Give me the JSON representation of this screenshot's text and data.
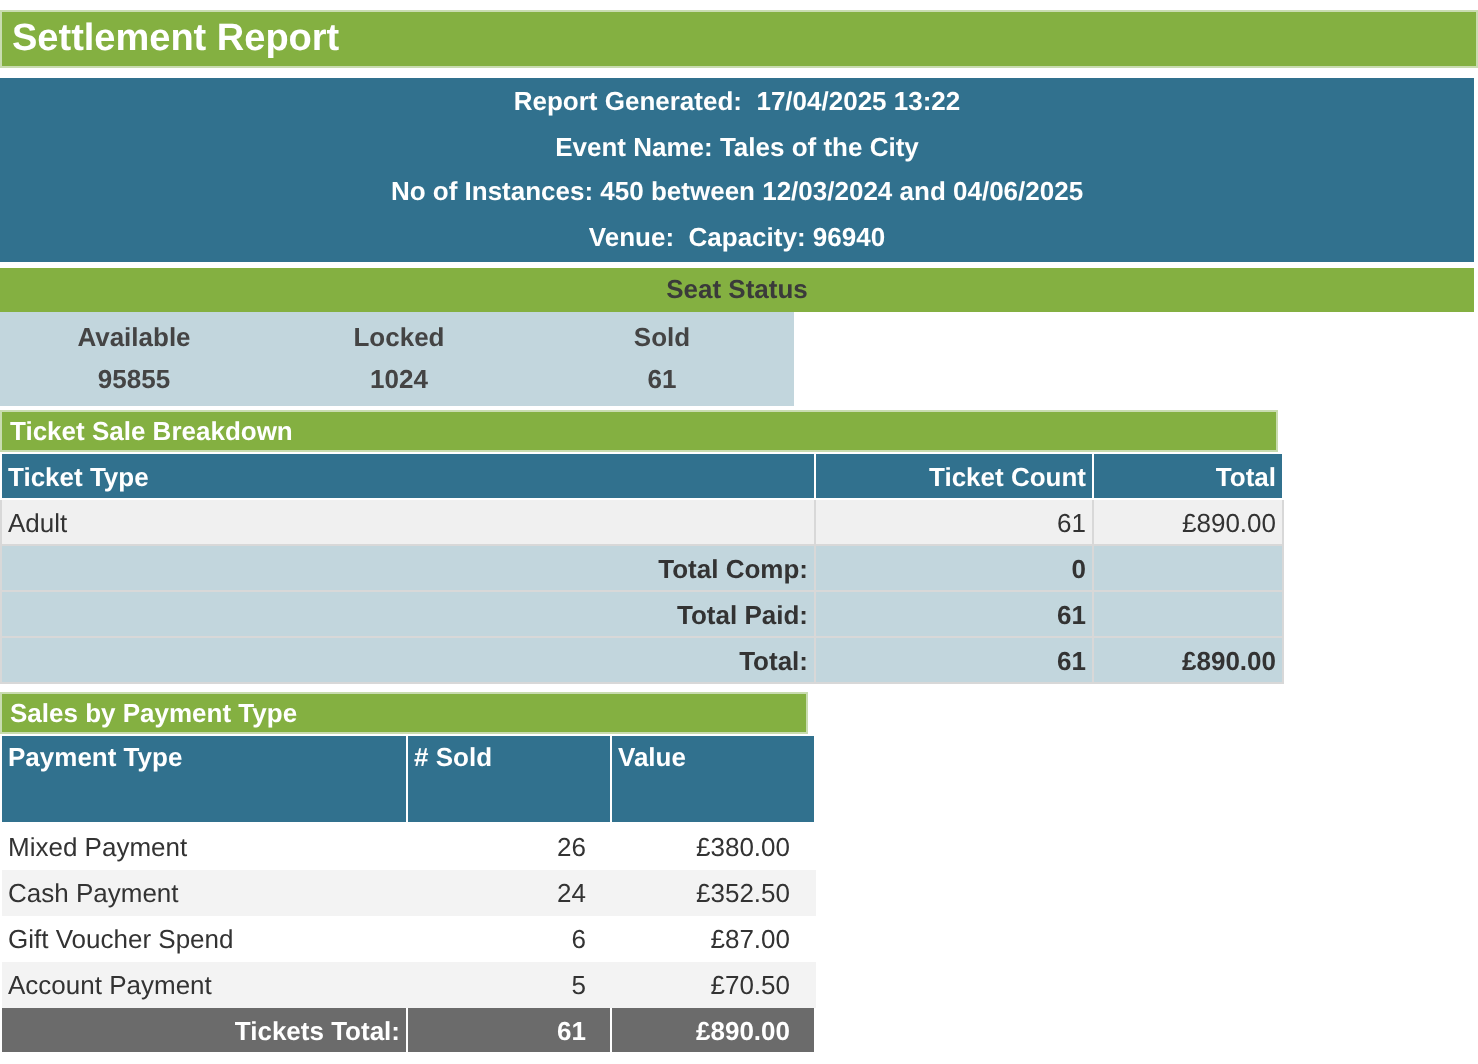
{
  "title": "Settlement Report",
  "header_lines": [
    "Report Generated:  17/04/2025 13:22",
    "Event Name: Tales of the City",
    "No of Instances: 450 between 12/03/2024 and 04/06/2025",
    "Venue:  Capacity: 96940"
  ],
  "seat_status": {
    "title": "Seat Status",
    "columns": [
      {
        "label": "Available",
        "value": "95855"
      },
      {
        "label": "Locked",
        "value": "1024"
      },
      {
        "label": "Sold",
        "value": "61"
      }
    ]
  },
  "ticket_breakdown": {
    "title": "Ticket Sale Breakdown",
    "columns": [
      "Ticket Type",
      "Ticket Count",
      "Total"
    ],
    "rows": [
      {
        "type": "Adult",
        "count": "61",
        "total": "£890.00"
      }
    ],
    "totals": [
      {
        "label": "Total Comp:",
        "count": "0"
      },
      {
        "label": "Total Paid:",
        "count": "61"
      },
      {
        "label": "Total:",
        "count": "61",
        "total": "£890.00"
      }
    ]
  },
  "payments": {
    "title": "Sales by Payment Type",
    "columns": [
      "Payment Type",
      "# Sold",
      "Value"
    ],
    "rows": [
      {
        "type": "Mixed Payment",
        "sold": "26",
        "value": "£380.00"
      },
      {
        "type": "Cash Payment",
        "sold": "24",
        "value": "£352.50"
      },
      {
        "type": "Gift Voucher Spend",
        "sold": "6",
        "value": "£87.00"
      },
      {
        "type": "Account Payment",
        "sold": "5",
        "value": "£70.50"
      }
    ],
    "total": {
      "label": "Tickets Total:",
      "sold": "61",
      "value": "£890.00"
    }
  }
}
